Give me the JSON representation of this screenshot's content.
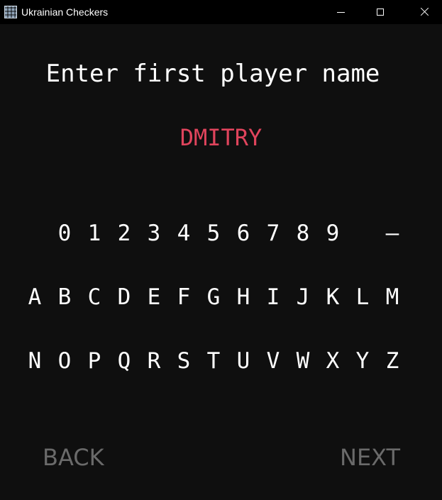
{
  "window": {
    "title": "Ukrainian Checkers",
    "app_icon": "checkerboard-icon",
    "controls": [
      "minimize-icon",
      "maximize-icon",
      "close-icon"
    ]
  },
  "prompt": "Enter first player name",
  "player_name": "DMITRY",
  "keyboard": {
    "digits": [
      "0",
      "1",
      "2",
      "3",
      "4",
      "5",
      "6",
      "7",
      "8",
      "9",
      "—"
    ],
    "row_a_m": [
      "A",
      "B",
      "C",
      "D",
      "E",
      "F",
      "G",
      "H",
      "I",
      "J",
      "K",
      "L",
      "M"
    ],
    "row_n_z": [
      "N",
      "O",
      "P",
      "Q",
      "R",
      "S",
      "T",
      "U",
      "V",
      "W",
      "X",
      "Y",
      "Z"
    ]
  },
  "nav": {
    "back": "BACK",
    "next": "NEXT"
  },
  "colors": {
    "background": "#0f0f0f",
    "text": "#ffffff",
    "name": "#e0445c",
    "nav_disabled": "#6a6a6a"
  }
}
